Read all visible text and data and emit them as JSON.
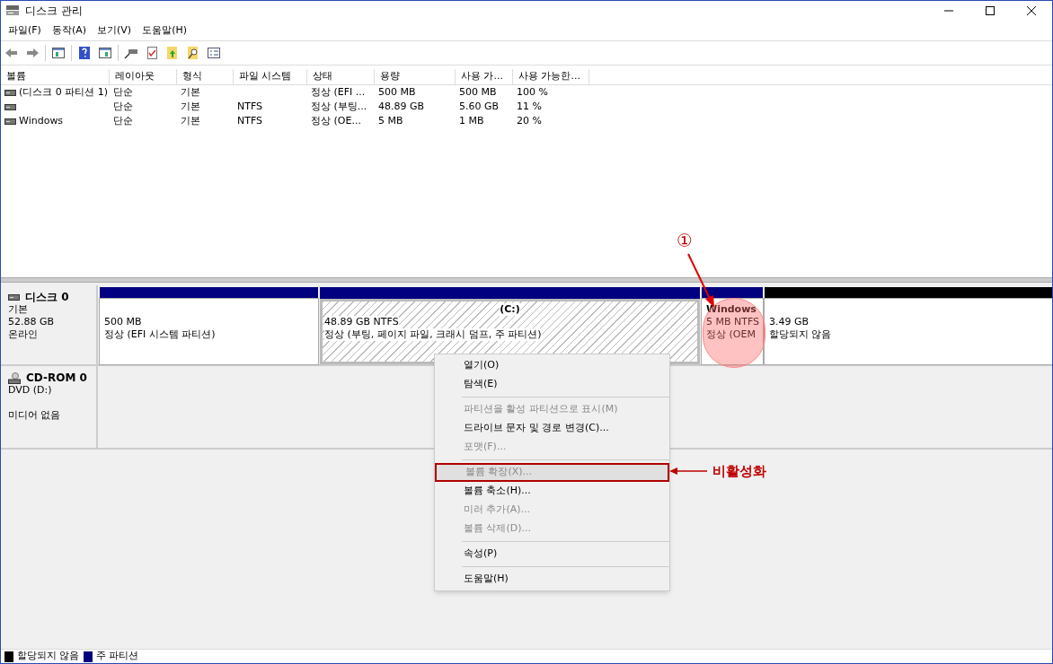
{
  "window": {
    "title": "디스크 관리"
  },
  "menu": [
    "파일(F)",
    "동작(A)",
    "보기(V)",
    "도움말(H)"
  ],
  "table": {
    "columns": [
      "볼륨",
      "레이아웃",
      "형식",
      "파일 시스템",
      "상태",
      "용량",
      "사용 가...",
      "사용 가능한..."
    ],
    "rows": [
      [
        "(디스크 0 파티션 1)",
        "단순",
        "기본",
        "",
        "정상 (EFI ...",
        "500 MB",
        "500 MB",
        "100 %"
      ],
      [
        "",
        "단순",
        "기본",
        "NTFS",
        "정상 (부팅...",
        "48.89 GB",
        "5.60 GB",
        "11 %"
      ],
      [
        "Windows",
        "단순",
        "기본",
        "NTFS",
        "정상 (OE...",
        "5 MB",
        "1 MB",
        "20 %"
      ]
    ]
  },
  "disks": [
    {
      "kind": "disk",
      "name": "디스크 0",
      "lines": [
        "기본",
        "52.88 GB",
        "온라인"
      ],
      "partitions": [
        {
          "kind": "primary",
          "selected": false,
          "lines": [
            "500 MB",
            "정상 (EFI 시스템 파티션)"
          ]
        },
        {
          "kind": "primary",
          "selected": true,
          "title": "(C:)",
          "lines": [
            "48.89 GB NTFS",
            "정상 (부팅, 페이지 파일, 크래시 덤프, 주 파티션)"
          ]
        },
        {
          "kind": "primary",
          "selected": false,
          "title": "Windows",
          "lines": [
            "5 MB NTFS",
            "정상 (OEM"
          ]
        },
        {
          "kind": "unallocated",
          "selected": false,
          "lines": [
            "3.49 GB",
            "할당되지 않음"
          ]
        }
      ]
    },
    {
      "kind": "cdrom",
      "name": "CD-ROM 0",
      "lines": [
        "DVD (D:)"
      ],
      "note": "미디어 없음"
    }
  ],
  "context_menu": [
    [
      {
        "label": "열기(O)",
        "disabled": false,
        "highlighted": false
      },
      {
        "label": "탐색(E)",
        "disabled": false,
        "highlighted": false
      }
    ],
    [
      {
        "label": "파티션을 활성 파티션으로 표시(M)",
        "disabled": true,
        "highlighted": false
      },
      {
        "label": "드라이브 문자 및 경로 변경(C)...",
        "disabled": false,
        "highlighted": false
      },
      {
        "label": "포맷(F)...",
        "disabled": true,
        "highlighted": false
      }
    ],
    [
      {
        "label": "볼륨 확장(X)...",
        "disabled": true,
        "highlighted": true
      },
      {
        "label": "볼륨 축소(H)...",
        "disabled": false,
        "highlighted": false
      },
      {
        "label": "미러 추가(A)...",
        "disabled": true,
        "highlighted": false
      },
      {
        "label": "볼륨 삭제(D)...",
        "disabled": true,
        "highlighted": false
      }
    ],
    [
      {
        "label": "속성(P)",
        "disabled": false,
        "highlighted": false
      }
    ],
    [
      {
        "label": "도움말(H)",
        "disabled": false,
        "highlighted": false
      }
    ]
  ],
  "annotations": {
    "marker": "①",
    "callout": "비활성화"
  },
  "legend": [
    {
      "label": "할당되지 않음",
      "color": "#000000"
    },
    {
      "label": "주 파티션",
      "color": "#000080"
    }
  ]
}
